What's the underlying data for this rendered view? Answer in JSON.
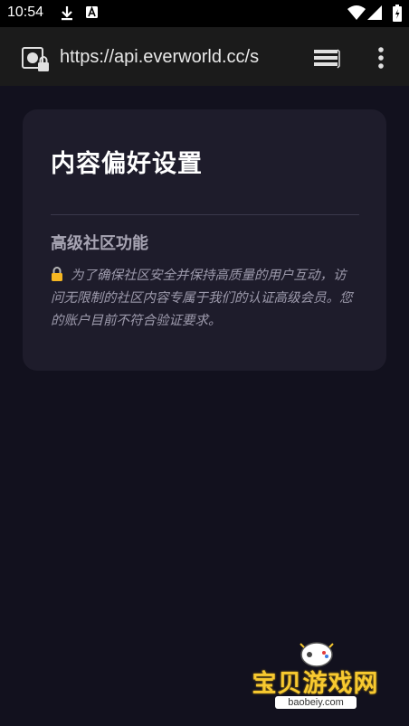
{
  "status_bar": {
    "time": "10:54",
    "icons": [
      "download-icon",
      "a-badge-icon",
      "wifi-icon",
      "signal-icon",
      "battery-icon"
    ]
  },
  "address_bar": {
    "url": "https://api.everworld.cc/s",
    "icons": [
      "site-security-icon",
      "tabs-icon",
      "more-menu-icon"
    ]
  },
  "card": {
    "title": "内容偏好设置",
    "section_title": "高级社区功能",
    "lock_icon": "lock-icon",
    "description": "为了确保社区安全并保持高质量的用户互动，访问无限制的社区内容专属于我们的认证高级会员。您的账户目前不符合验证要求。"
  },
  "watermark": {
    "brand": "宝贝游戏网",
    "site": "baobeiy.com"
  },
  "colors": {
    "background": "#12111e",
    "card": "#1e1c2b",
    "accent_watermark": "#f7c930"
  }
}
